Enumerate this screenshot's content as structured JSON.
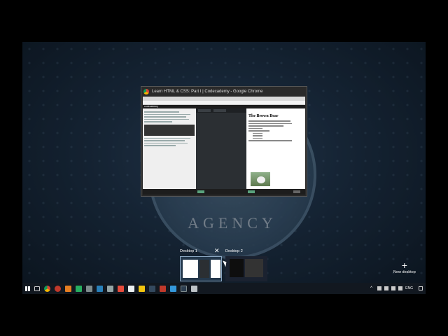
{
  "window": {
    "title": "Learn HTML & CSS: Part I | Codecademy - Google Chrome",
    "site_name": "codecademy",
    "preview_heading": "The Brown Bear"
  },
  "task_view": {
    "desktops": [
      "Desktop 1",
      "Desktop 2"
    ],
    "close_symbol": "✕",
    "new_desktop_symbol": "+",
    "new_desktop_label": "New desktop"
  },
  "taskbar": {
    "language": "ENG",
    "time": "",
    "date": ""
  },
  "colors": {
    "wallpaper": "#1c2f44",
    "taskbar": "#121820",
    "accent": "#8aa6c2"
  }
}
